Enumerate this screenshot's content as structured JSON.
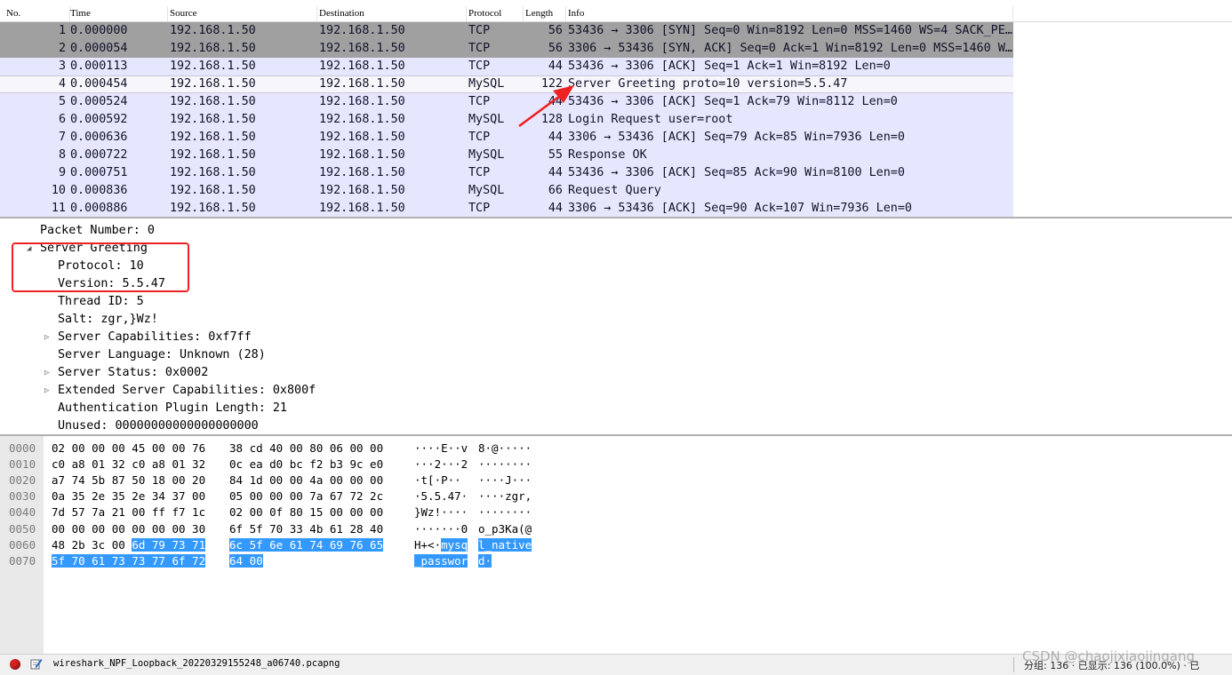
{
  "packet_list": {
    "columns": [
      "No.",
      "Time",
      "Source",
      "Destination",
      "Protocol",
      "Length",
      "Info"
    ],
    "rows": [
      {
        "no": "1",
        "time": "0.000000",
        "src": "192.168.1.50",
        "dst": "192.168.1.50",
        "proto": "TCP",
        "len": "56",
        "info": "53436 → 3306 [SYN] Seq=0 Win=8192 Len=0 MSS=1460 WS=4 SACK_PE…",
        "style": "dark"
      },
      {
        "no": "2",
        "time": "0.000054",
        "src": "192.168.1.50",
        "dst": "192.168.1.50",
        "proto": "TCP",
        "len": "56",
        "info": "3306 → 53436 [SYN, ACK] Seq=0 Ack=1 Win=8192 Len=0 MSS=1460 W…",
        "style": "dark"
      },
      {
        "no": "3",
        "time": "0.000113",
        "src": "192.168.1.50",
        "dst": "192.168.1.50",
        "proto": "TCP",
        "len": "44",
        "info": "53436 → 3306 [ACK] Seq=1 Ack=1 Win=8192 Len=0",
        "style": "tcp"
      },
      {
        "no": "4",
        "time": "0.000454",
        "src": "192.168.1.50",
        "dst": "192.168.1.50",
        "proto": "MySQL",
        "len": "122",
        "info": "Server Greeting proto=10 version=5.5.47",
        "style": "sel"
      },
      {
        "no": "5",
        "time": "0.000524",
        "src": "192.168.1.50",
        "dst": "192.168.1.50",
        "proto": "TCP",
        "len": "44",
        "info": "53436 → 3306 [ACK] Seq=1 Ack=79 Win=8112 Len=0",
        "style": "tcp"
      },
      {
        "no": "6",
        "time": "0.000592",
        "src": "192.168.1.50",
        "dst": "192.168.1.50",
        "proto": "MySQL",
        "len": "128",
        "info": "Login Request user=root",
        "style": "tcp"
      },
      {
        "no": "7",
        "time": "0.000636",
        "src": "192.168.1.50",
        "dst": "192.168.1.50",
        "proto": "TCP",
        "len": "44",
        "info": "3306 → 53436 [ACK] Seq=79 Ack=85 Win=7936 Len=0",
        "style": "tcp"
      },
      {
        "no": "8",
        "time": "0.000722",
        "src": "192.168.1.50",
        "dst": "192.168.1.50",
        "proto": "MySQL",
        "len": "55",
        "info": "Response OK",
        "style": "tcp"
      },
      {
        "no": "9",
        "time": "0.000751",
        "src": "192.168.1.50",
        "dst": "192.168.1.50",
        "proto": "TCP",
        "len": "44",
        "info": "53436 → 3306 [ACK] Seq=85 Ack=90 Win=8100 Len=0",
        "style": "tcp"
      },
      {
        "no": "10",
        "time": "0.000836",
        "src": "192.168.1.50",
        "dst": "192.168.1.50",
        "proto": "MySQL",
        "len": "66",
        "info": "Request Query",
        "style": "tcp"
      },
      {
        "no": "11",
        "time": "0.000886",
        "src": "192.168.1.50",
        "dst": "192.168.1.50",
        "proto": "TCP",
        "len": "44",
        "info": "3306 → 53436 [ACK] Seq=90 Ack=107 Win=7936 Len=0",
        "style": "tcp"
      }
    ]
  },
  "details": [
    {
      "text": "Packet Number: 0",
      "level": 0,
      "toggle": "none"
    },
    {
      "text": "Server Greeting",
      "level": 0,
      "toggle": "open"
    },
    {
      "text": "Protocol: 10",
      "level": 1,
      "toggle": "none"
    },
    {
      "text": "Version: 5.5.47",
      "level": 1,
      "toggle": "none"
    },
    {
      "text": "Thread ID: 5",
      "level": 1,
      "toggle": "none"
    },
    {
      "text": "Salt: zgr,}Wz!",
      "level": 1,
      "toggle": "none"
    },
    {
      "text": "Server Capabilities: 0xf7ff",
      "level": 1,
      "toggle": "closed"
    },
    {
      "text": "Server Language: Unknown (28)",
      "level": 1,
      "toggle": "none"
    },
    {
      "text": "Server Status: 0x0002",
      "level": 1,
      "toggle": "closed"
    },
    {
      "text": "Extended Server Capabilities: 0x800f",
      "level": 1,
      "toggle": "closed"
    },
    {
      "text": "Authentication Plugin Length: 21",
      "level": 1,
      "toggle": "none"
    },
    {
      "text": "Unused: 00000000000000000000",
      "level": 1,
      "toggle": "none"
    }
  ],
  "hex_dump": [
    {
      "offset": "0000",
      "hex_a": "02 00 00 00 45 00 00 76",
      "hex_b": "38 cd 40 00 80 06 00 00",
      "ascii_a": "····E··v",
      "ascii_b": "8·@·····",
      "sel_from": -1
    },
    {
      "offset": "0010",
      "hex_a": "c0 a8 01 32 c0 a8 01 32",
      "hex_b": "0c ea d0 bc f2 b3 9c e0",
      "ascii_a": "···2···2",
      "ascii_b": "········",
      "sel_from": -1
    },
    {
      "offset": "0020",
      "hex_a": "a7 74 5b 87 50 18 00 20",
      "hex_b": "84 1d 00 00 4a 00 00 00",
      "ascii_a": "·t[·P·· ",
      "ascii_b": "····J···",
      "sel_from": -1
    },
    {
      "offset": "0030",
      "hex_a": "0a 35 2e 35 2e 34 37 00",
      "hex_b": "05 00 00 00 7a 67 72 2c",
      "ascii_a": "·5.5.47·",
      "ascii_b": "····zgr,",
      "sel_from": -1
    },
    {
      "offset": "0040",
      "hex_a": "7d 57 7a 21 00 ff f7 1c",
      "hex_b": "02 00 0f 80 15 00 00 00",
      "ascii_a": "}Wz!····",
      "ascii_b": "········",
      "sel_from": -1
    },
    {
      "offset": "0050",
      "hex_a": "00 00 00 00 00 00 00 30",
      "hex_b": "6f 5f 70 33 4b 61 28 40",
      "ascii_a": "·······0",
      "ascii_b": "o_p3Ka(@",
      "sel_from": -1
    },
    {
      "offset": "0060",
      "hex_a": "48 2b 3c 00 6d 79 73 71",
      "hex_b": "6c 5f 6e 61 74 69 76 65",
      "ascii_a": "H+<·mysq",
      "ascii_b": "l_native",
      "sel_from": 4
    },
    {
      "offset": "0070",
      "hex_a": "5f 70 61 73 73 77 6f 72",
      "hex_b": "64 00",
      "ascii_a": "_passwor",
      "ascii_b": "d·",
      "sel_from": 0
    }
  ],
  "status": {
    "file": "wireshark_NPF_Loopback_20220329155248_a06740.pcapng",
    "counts": "分组: 136 · 已显示: 136 (100.0%) · 已",
    "watermark": "CSDN @chaojixiaojingang"
  },
  "colors": {
    "dark_row": "#a0a0a0",
    "tcp_row": "#e7e6ff",
    "selection": "#3399ff",
    "annotation_red": "#ee2222"
  }
}
